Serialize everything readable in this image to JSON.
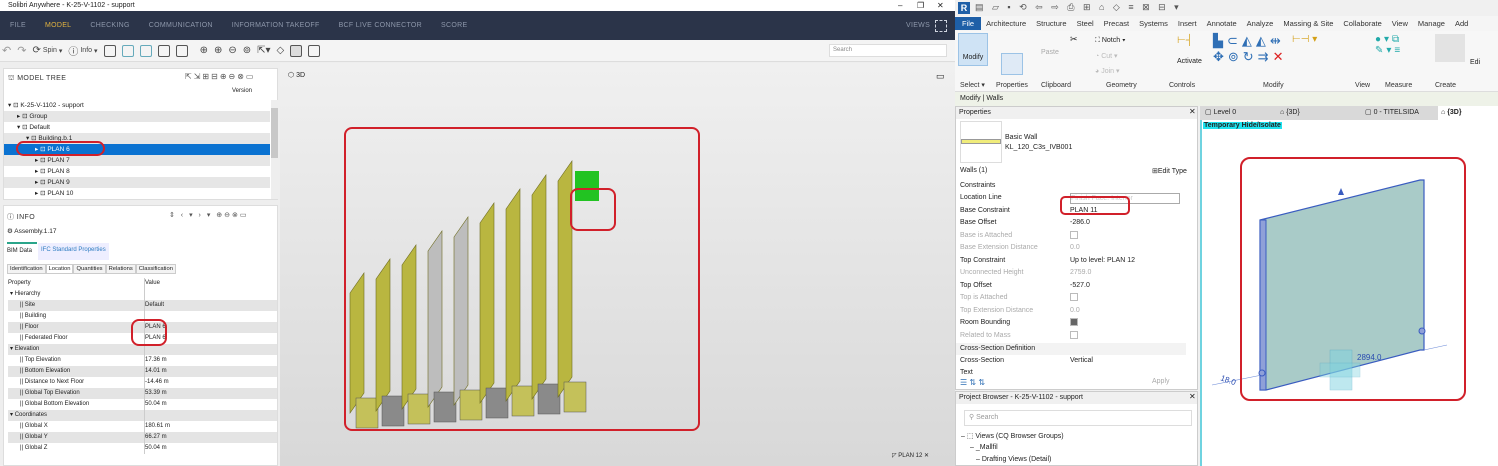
{
  "solibri": {
    "title": "Solibri Anywhere - K-25-V-1102 - support",
    "window_controls": [
      "–",
      "❐",
      "✕"
    ],
    "nav": [
      {
        "label": "FILE"
      },
      {
        "label": "MODEL",
        "active": true
      },
      {
        "label": "CHECKING"
      },
      {
        "label": "COMMUNICATION"
      },
      {
        "label": "INFORMATION TAKEOFF"
      },
      {
        "label": "BCF LIVE CONNECTOR"
      },
      {
        "label": "SCORE"
      }
    ],
    "views_label": "VIEWS",
    "toolbar": {
      "spin": "Spin",
      "info": "Info"
    },
    "search_placeholder": "Search",
    "model_tree": {
      "title": "MODEL TREE",
      "version_col": "Version",
      "rows": [
        {
          "label": "K-25-V-1102 - support",
          "indent": 0,
          "icon": "▾"
        },
        {
          "label": "Group",
          "indent": 1,
          "icon": "▸"
        },
        {
          "label": "Default",
          "indent": 1,
          "icon": "▾"
        },
        {
          "label": "Building.b.1",
          "indent": 2,
          "icon": "▾"
        },
        {
          "label": "PLAN 6",
          "indent": 3,
          "icon": "▸",
          "selected": true
        },
        {
          "label": "PLAN 7",
          "indent": 3,
          "icon": "▸"
        },
        {
          "label": "PLAN 8",
          "indent": 3,
          "icon": "▸"
        },
        {
          "label": "PLAN 9",
          "indent": 3,
          "icon": "▸"
        },
        {
          "label": "PLAN 10",
          "indent": 3,
          "icon": "▸"
        }
      ]
    },
    "info": {
      "title": "INFO",
      "object": "Assembly.1.17",
      "tabs": [
        "BIM Data",
        "IFC Standard Properties"
      ],
      "subtabs": [
        "Identification",
        "Location",
        "Quantities",
        "Relations",
        "Classification"
      ],
      "col_property": "Property",
      "col_value": "Value",
      "rows": [
        {
          "p": "Hierarchy",
          "v": "",
          "group": true
        },
        {
          "p": "Site",
          "v": "Default"
        },
        {
          "p": "Building",
          "v": ""
        },
        {
          "p": "Floor",
          "v": "PLAN 6"
        },
        {
          "p": "Federated Floor",
          "v": "PLAN 6"
        },
        {
          "p": "Elevation",
          "v": "",
          "group": true
        },
        {
          "p": "Top Elevation",
          "v": "17.36 m"
        },
        {
          "p": "Bottom Elevation",
          "v": "14.01 m"
        },
        {
          "p": "Distance to Next Floor",
          "v": "-14.46 m"
        },
        {
          "p": "Global Top Elevation",
          "v": "53.39 m"
        },
        {
          "p": "Global Bottom Elevation",
          "v": "50.04 m"
        },
        {
          "p": "Coordinates",
          "v": "",
          "group": true
        },
        {
          "p": "Global X",
          "v": "180.61 m"
        },
        {
          "p": "Global Y",
          "v": "66.27 m"
        },
        {
          "p": "Global Z",
          "v": "50.04 m"
        }
      ]
    },
    "viewport": {
      "label": "3D",
      "plan_label": "PLAN 12"
    },
    "colors": {
      "nav": "#2b3449",
      "accent": "#e2b340",
      "select": "#0a72d1",
      "wall": "#b9b640",
      "highlight": "#22c322",
      "annotation": "#d1202a"
    }
  },
  "revit": {
    "logo": "R",
    "tabs": [
      "File",
      "Architecture",
      "Structure",
      "Steel",
      "Precast",
      "Systems",
      "Insert",
      "Annotate",
      "Analyze",
      "Massing & Site",
      "Collaborate",
      "View",
      "Manage",
      "Add"
    ],
    "ribbon": {
      "modify": "Modify",
      "notch": "Notch",
      "cut": "Cut",
      "join": "Join",
      "paste": "Paste",
      "activate": "Activate",
      "edit": "Edi",
      "groups": [
        "Select ▾",
        "Properties",
        "Clipboard",
        "Geometry",
        "Controls",
        "Modify",
        "View",
        "Measure",
        "Create"
      ]
    },
    "context": "Modify | Walls",
    "properties": {
      "title": "Properties",
      "family": "Basic Wall",
      "type": "KL_120_C3s_IVB001",
      "selector": "Walls (1)",
      "edit_type": "Edit Type",
      "sections": {
        "constraints": "Constraints",
        "cross": "Cross-Section Definition",
        "text": "Text"
      },
      "rows": [
        {
          "p": "Location Line",
          "v": "Finish Face: Interior"
        },
        {
          "p": "Base Constraint",
          "v": "PLAN 11"
        },
        {
          "p": "Base Offset",
          "v": "-286.0"
        },
        {
          "p": "Base is Attached",
          "v": "",
          "dim": true,
          "check": false
        },
        {
          "p": "Base Extension Distance",
          "v": "0.0",
          "dim": true
        },
        {
          "p": "Top Constraint",
          "v": "Up to level: PLAN 12"
        },
        {
          "p": "Unconnected Height",
          "v": "2759.0",
          "dim": true
        },
        {
          "p": "Top Offset",
          "v": "-527.0"
        },
        {
          "p": "Top is Attached",
          "v": "",
          "dim": true,
          "check": false
        },
        {
          "p": "Top Extension Distance",
          "v": "0.0",
          "dim": true
        },
        {
          "p": "Room Bounding",
          "v": "",
          "check": true
        },
        {
          "p": "Related to Mass",
          "v": "",
          "dim": true,
          "check": false
        }
      ],
      "cross_row": {
        "p": "Cross-Section",
        "v": "Vertical"
      },
      "apply": "Apply"
    },
    "browser": {
      "title": "Project Browser - K-25-V-1102 - support",
      "search": "Search",
      "items": [
        "Views (CQ Browser Groups)",
        "_Mallfil",
        "Drafting Views (Detail)"
      ]
    },
    "view_tabs": [
      "Level 0",
      "{3D}",
      "0 - TITELSIDA",
      "{3D}"
    ],
    "hide_isolate": "Temporary Hide/Isolate",
    "dims": [
      "2894.0",
      "18.0"
    ]
  }
}
